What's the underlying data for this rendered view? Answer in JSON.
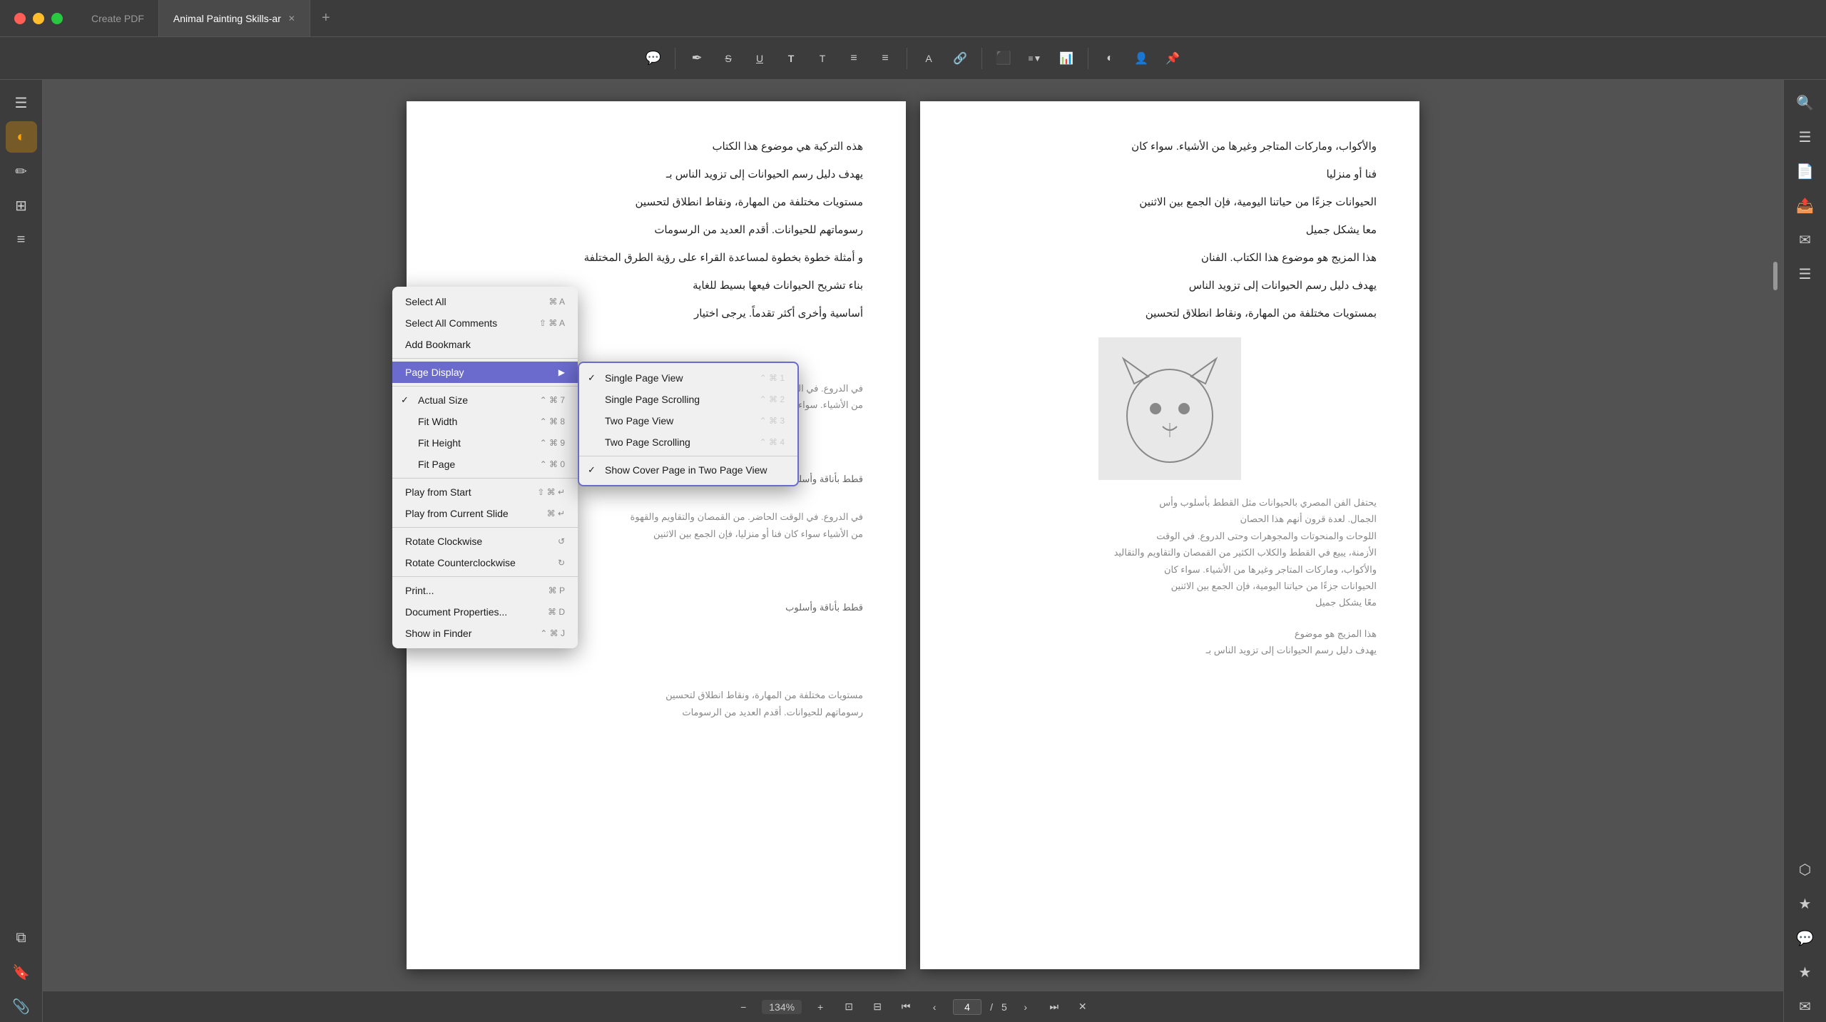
{
  "app": {
    "title": "Create PDF",
    "activeTab": "Animal Painting Skills-ar",
    "tabs": [
      {
        "label": "Create PDF",
        "active": false,
        "closable": false
      },
      {
        "label": "Animal Painting Skills-ar",
        "active": true,
        "closable": true
      }
    ],
    "addTab": "+"
  },
  "toolbar": {
    "icons": [
      "✏️",
      "✒️",
      "S",
      "U",
      "T",
      "T",
      "≡",
      "≡",
      "|",
      "A",
      "🔗",
      "⬛",
      "≡",
      "📊",
      "◐",
      "👤",
      "📌"
    ]
  },
  "leftSidebar": {
    "items": [
      {
        "icon": "☰",
        "name": "menu",
        "active": false
      },
      {
        "icon": "◐",
        "name": "highlight",
        "active": true
      },
      {
        "icon": "✏️",
        "name": "edit",
        "active": false
      },
      {
        "icon": "☰",
        "name": "pages",
        "active": false
      },
      {
        "icon": "≡",
        "name": "list",
        "active": false
      },
      {
        "icon": "↑",
        "name": "up",
        "active": false
      },
      {
        "icon": "↓",
        "name": "down",
        "active": false
      },
      {
        "icon": "⚙",
        "name": "settings",
        "active": false
      },
      {
        "icon": "🔖",
        "name": "bookmark",
        "active": false
      },
      {
        "icon": "📎",
        "name": "attach",
        "active": false
      }
    ]
  },
  "rightSidebar": {
    "items": [
      {
        "icon": "🔍",
        "name": "search"
      },
      {
        "icon": "☰",
        "name": "panel1"
      },
      {
        "icon": "📄",
        "name": "panel2"
      },
      {
        "icon": "📤",
        "name": "panel3"
      },
      {
        "icon": "✉",
        "name": "panel4"
      },
      {
        "icon": "☰",
        "name": "panel5"
      },
      {
        "icon": "⬡",
        "name": "panel6"
      },
      {
        "icon": "★",
        "name": "panel7"
      },
      {
        "icon": "⚙",
        "name": "panel8"
      },
      {
        "icon": "★",
        "name": "panel9"
      },
      {
        "icon": "✉",
        "name": "panel10"
      }
    ]
  },
  "pdf": {
    "currentPage": 4,
    "totalPages": 5,
    "zoom": "134%",
    "pages": [
      {
        "text1": "والأكواب، وماركات المتاجر وغيرها من الأشياء. سواء كان",
        "text2": "فنا أو منزليا",
        "text3": "الحيوانات جزءًا من حياتنا اليومية، فإن الجمع بين الاثنين",
        "text4": "معا يشكل جميل",
        "text5": "هذا المزيج هو موضوع هذا الكتاب. الفنان",
        "text6": "يهدف دليل رسم الحيوانات إلى تزويد الناس",
        "text7": "بمستويات مختلفة من المهارة، ونقاط انطلاق لتحسين"
      }
    ],
    "leftPageText": [
      "هذه التركية هي موضوع هذا الكتاب",
      "يهدف دليل رسم الحيوانات إلى تزويد الناس بـ",
      "مستويات مختلفة من المهارة، ونقاط انطلاق لتحسين",
      "رسوماتهم للحيوانات. أقدم العديد من الرسومات",
      "و أمثلة خطوة بخطوة لمساعدة القراء على رؤية الطرق المختلفة",
      "بناء تشريح الحيوانات فيعها بسيط للغاية",
      "أساسية وأخرى أكثر تقدماً. يرجى اختيار"
    ]
  },
  "contextMenu": {
    "items": [
      {
        "label": "Select All",
        "shortcut": "⌘ A",
        "hasCheck": false,
        "hasSep": false
      },
      {
        "label": "Select All Comments",
        "shortcut": "⇧ ⌘ A",
        "hasCheck": false,
        "hasSep": false
      },
      {
        "label": "Add Bookmark",
        "shortcut": "",
        "hasCheck": false,
        "hasSep": true
      },
      {
        "label": "Page Display",
        "shortcut": "",
        "hasCheck": false,
        "hasSep": false,
        "hasArrow": true,
        "active": true
      },
      {
        "label": "Actual Size",
        "shortcut": "⌃ ⌘ 7",
        "hasCheck": true,
        "checked": true,
        "hasSep": false
      },
      {
        "label": "Fit Width",
        "shortcut": "⌃ ⌘ 8",
        "hasCheck": true,
        "checked": false,
        "hasSep": false
      },
      {
        "label": "Fit Height",
        "shortcut": "⌃ ⌘ 9",
        "hasCheck": true,
        "checked": false,
        "hasSep": false
      },
      {
        "label": "Fit Page",
        "shortcut": "⌃ ⌘ 0",
        "hasCheck": true,
        "checked": false,
        "hasSep": true
      },
      {
        "label": "Play from Start",
        "shortcut": "⇧ ⌘ ↵",
        "hasCheck": false,
        "hasSep": false
      },
      {
        "label": "Play from Current Slide",
        "shortcut": "⌘ ↵",
        "hasCheck": false,
        "hasSep": true
      },
      {
        "label": "Rotate Clockwise",
        "shortcut": "↺",
        "hasCheck": false,
        "hasSep": false
      },
      {
        "label": "Rotate Counterclockwise",
        "shortcut": "↻",
        "hasCheck": false,
        "hasSep": true
      },
      {
        "label": "Print...",
        "shortcut": "⌘ P",
        "hasCheck": false,
        "hasSep": false
      },
      {
        "label": "Document Properties...",
        "shortcut": "⌘ D",
        "hasCheck": false,
        "hasSep": false
      },
      {
        "label": "Show in Finder",
        "shortcut": "⌃ ⌘ J",
        "hasCheck": false,
        "hasSep": false
      }
    ]
  },
  "submenu": {
    "items": [
      {
        "label": "Single Page View",
        "shortcut": "⌃ ⌘ 1",
        "hasCheck": true,
        "checked": true
      },
      {
        "label": "Single Page Scrolling",
        "shortcut": "⌃ ⌘ 2",
        "hasCheck": true,
        "checked": false
      },
      {
        "label": "Two Page View",
        "shortcut": "⌃ ⌘ 3",
        "hasCheck": true,
        "checked": false
      },
      {
        "label": "Two Page Scrolling",
        "shortcut": "⌃ ⌘ 4",
        "hasCheck": true,
        "checked": false
      },
      {
        "sep": true
      },
      {
        "label": "Show Cover Page in Two Page View",
        "shortcut": "",
        "hasCheck": true,
        "checked": true
      }
    ]
  },
  "bottomBar": {
    "zoomOut": "−",
    "zoomIn": "+",
    "zoomLevel": "134%",
    "fitPage": "⊡",
    "navFirst": "⏮",
    "navPrev": "‹",
    "navNext": "›",
    "navLast": "⏭",
    "currentPage": "4",
    "totalPages": "5",
    "close": "✕"
  }
}
